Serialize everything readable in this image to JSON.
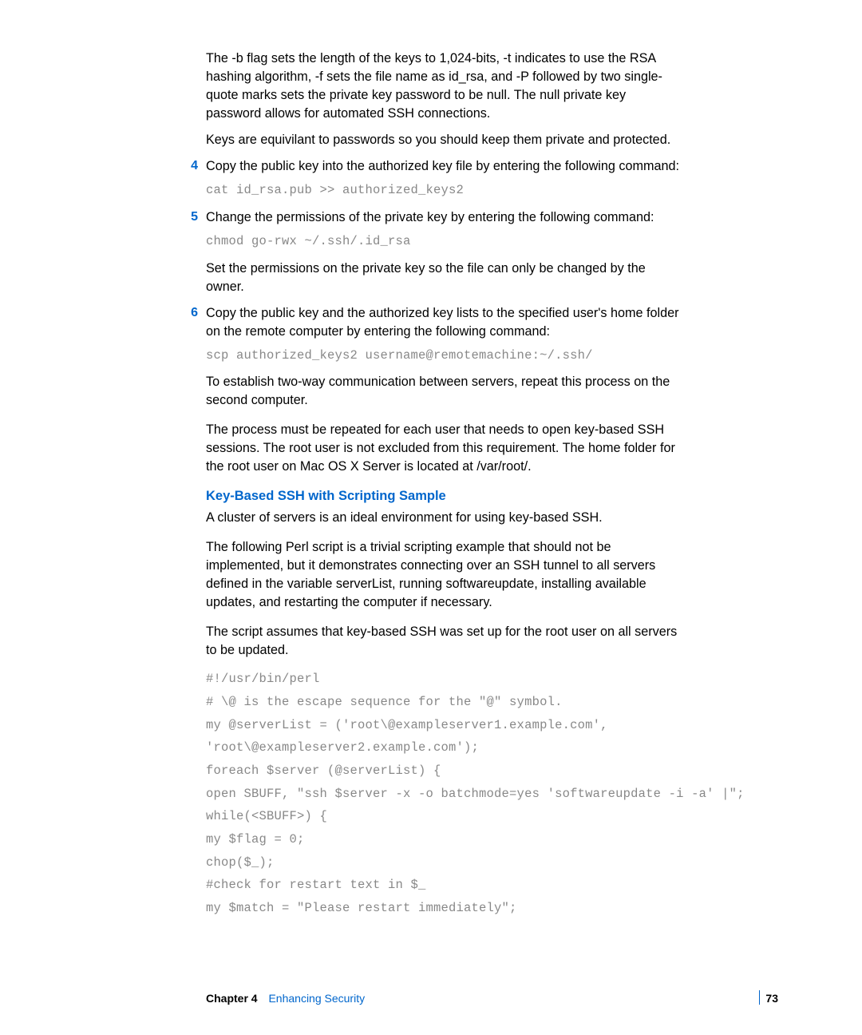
{
  "p1": "The -b flag sets the length of the keys to 1,024-bits, -t indicates to use the RSA hashing algorithm, -f sets the file name as id_rsa, and -P followed by two single-quote marks sets the private key password to be null. The null private key password allows for automated SSH connections.",
  "p2": "Keys are equivilant to passwords so you should keep them private and protected.",
  "step4_num": "4",
  "step4_text": "Copy the public key into the authorized key file by entering the following command:",
  "code4": "cat id_rsa.pub >> authorized_keys2",
  "step5_num": "5",
  "step5_text": "Change the permissions of the private key by entering the following command:",
  "code5": "chmod go-rwx ~/.ssh/.id_rsa",
  "p5a": "Set the permissions on the private key so the file can only be changed by the owner.",
  "step6_num": "6",
  "step6_text": "Copy the public key and the authorized key lists to the specified user's home folder on the remote computer by entering the following command:",
  "code6": "scp authorized_keys2 username@remotemachine:~/.ssh/",
  "p6a": "To establish two-way communication between servers, repeat this process on the second computer.",
  "p6b": "The process must be repeated for each user that needs to open key-based SSH sessions. The root user is not excluded from this requirement. The home folder for the root user on Mac OS X Server is located at /var/root/.",
  "heading": "Key-Based SSH with Scripting Sample",
  "h_p1": "A cluster of servers is an ideal environment for using key-based SSH.",
  "h_p2": "The following Perl script is a trivial scripting example that should not be implemented, but it demonstrates connecting over an SSH tunnel to all servers defined in the variable serverList, running softwareupdate, installing available updates, and restarting the computer if necessary.",
  "h_p3": "The script assumes that key-based SSH was set up for the root user on all servers to be updated.",
  "script_lines": [
    "#!/usr/bin/perl",
    "# \\@ is the escape sequence for the \"@\" symbol.",
    "my @serverList = ('root\\@exampleserver1.example.com',",
    "'root\\@exampleserver2.example.com');",
    "foreach $server (@serverList) {",
    "open SBUFF, \"ssh $server -x -o batchmode=yes 'softwareupdate -i -a' |\";",
    "while(<SBUFF>) {",
    "my $flag = 0;",
    "chop($_);",
    "#check for restart text in $_",
    "my $match = \"Please restart immediately\";"
  ],
  "footer": {
    "chapter_label": "Chapter 4",
    "chapter_title": "Enhancing Security",
    "page": "73"
  }
}
